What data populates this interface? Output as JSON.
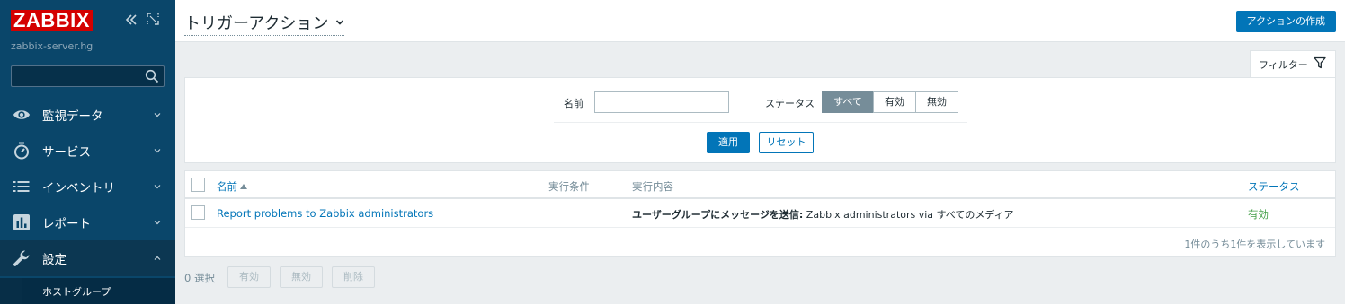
{
  "sidebar": {
    "logo": "ZABBIX",
    "server_name": "zabbix-server.hg",
    "search": {
      "value": "",
      "placeholder": ""
    },
    "collapse_icon": "double-chevron-left-icon",
    "kiosk_icon": "expand-icon",
    "items": [
      {
        "label": "監視データ",
        "icon": "eye-icon",
        "expanded": false
      },
      {
        "label": "サービス",
        "icon": "stopwatch-icon",
        "expanded": false
      },
      {
        "label": "インベントリ",
        "icon": "list-icon",
        "expanded": false
      },
      {
        "label": "レポート",
        "icon": "bar-chart-icon",
        "expanded": false
      },
      {
        "label": "設定",
        "icon": "wrench-icon",
        "expanded": true
      }
    ],
    "subitem": "ホストグループ"
  },
  "header": {
    "title": "トリガーアクション",
    "create_button": "アクションの作成"
  },
  "filter": {
    "tab_label": "フィルター",
    "name_label": "名前",
    "name_value": "",
    "status_label": "ステータス",
    "status_options": [
      "すべて",
      "有効",
      "無効"
    ],
    "status_selected": "すべて",
    "apply_button": "適用",
    "reset_button": "リセット"
  },
  "table": {
    "columns": [
      "名前",
      "実行条件",
      "実行内容",
      "ステータス"
    ],
    "sort_column": "名前",
    "sort_direction": "asc",
    "rows": [
      {
        "name": "Report problems to Zabbix administrators",
        "conditions": "",
        "operation_bold": "ユーザーグループにメッセージを送信:",
        "operation_rest": " Zabbix administrators via すべてのメディア",
        "status": "有効"
      }
    ],
    "footer": "1件のうち1件を表示しています"
  },
  "actions": {
    "selected_count": "0 選択",
    "enable_button": "有効",
    "disable_button": "無効",
    "delete_button": "削除"
  },
  "colors": {
    "sidebar_bg": "#0a466a",
    "accent": "#0275b8",
    "logo_red": "#d40000",
    "status_green": "#429e47"
  }
}
